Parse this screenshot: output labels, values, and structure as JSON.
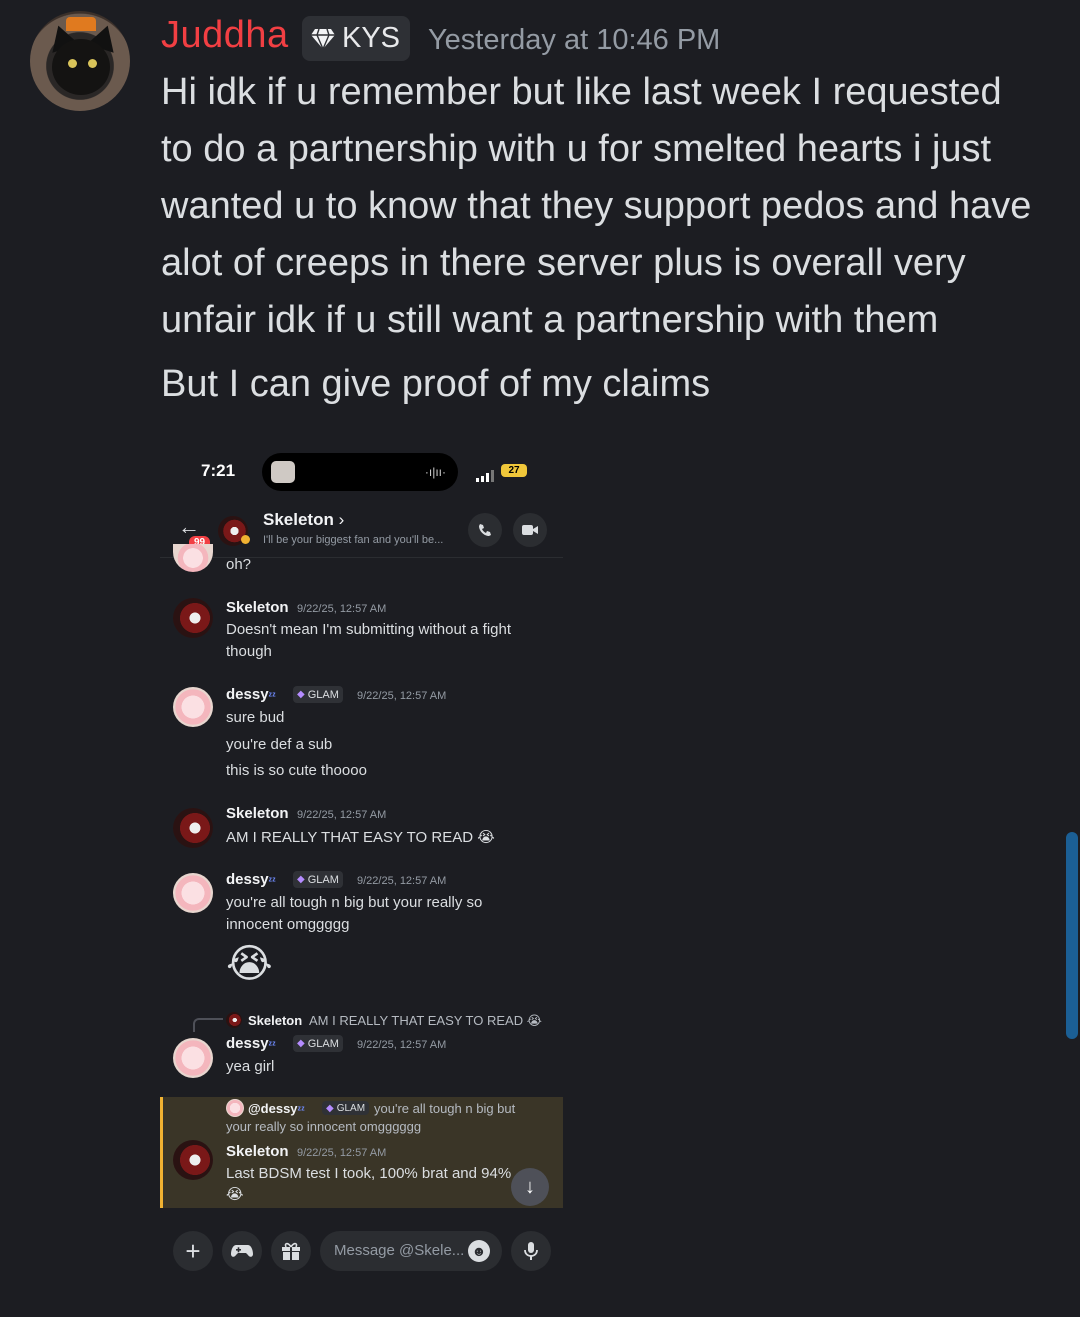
{
  "message": {
    "username": "Juddha",
    "guild_tag": "KYS",
    "timestamp": "Yesterday at 10:46 PM",
    "lines": [
      "Hi idk if u remember but like last week I requested",
      "to do a partnership with u for smelted hearts i just",
      "wanted u to know that they support pedos and have",
      "alot of creeps in there server plus is overall very",
      "unfair idk if u still want a partnership with them"
    ],
    "followup": "But I can give proof of my claims"
  },
  "screenshot": {
    "status_time": "7:21",
    "battery": "27",
    "header": {
      "name": "Skeleton",
      "chevron": "›",
      "status": "I'll be your biggest fan and you'll be...",
      "badge": "99"
    },
    "messages": [
      {
        "text_only": "oh?"
      },
      {
        "author": "Skeleton",
        "time": "9/22/25, 12:57 AM",
        "lines": [
          "Doesn't mean I'm submitting without a fight",
          "though"
        ]
      },
      {
        "author": "dessy",
        "zz": "ᶻᶻ",
        "tag": "GLAM",
        "time": "9/22/25, 12:57 AM",
        "lines": [
          "sure bud",
          "you're def a sub",
          "this is so cute thoooo"
        ]
      },
      {
        "author": "Skeleton",
        "time": "9/22/25, 12:57 AM",
        "lines": [
          "AM I REALLY THAT EASY TO READ 😭"
        ]
      },
      {
        "author": "dessy",
        "zz": "ᶻᶻ",
        "tag": "GLAM",
        "time": "9/22/25, 12:57 AM",
        "lines": [
          "you're all tough n big but your really so",
          "innocent omggggg"
        ],
        "emoji": "😭"
      },
      {
        "reply_to": {
          "author": "Skeleton",
          "text": "AM I REALLY THAT EASY TO READ 😭"
        },
        "author": "dessy",
        "zz": "ᶻᶻ",
        "tag": "GLAM",
        "time": "9/22/25, 12:57 AM",
        "lines": [
          "yea girl"
        ]
      },
      {
        "reply_to": {
          "author": "@dessy",
          "zz": "ᶻᶻ",
          "tag": "GLAM",
          "text": "you're all tough n big but",
          "text2": "your really so innocent omgggggg"
        },
        "author": "Skeleton",
        "time": "9/22/25, 12:57 AM",
        "lines": [
          "Last BDSM test I took, 100% brat and 94%",
          "😭"
        ]
      }
    ],
    "composer_placeholder": "Message @Skele..."
  }
}
